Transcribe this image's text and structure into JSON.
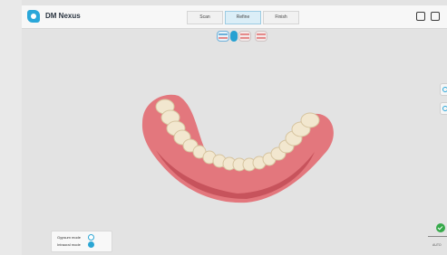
{
  "app": {
    "name": "DM Nexus"
  },
  "steps": {
    "scan": "Scan",
    "refine": "Refine",
    "finish": "Finish",
    "active": "Refine"
  },
  "view_toggles": {
    "selected": "upper",
    "items": [
      "upper",
      "mid",
      "lower",
      "both"
    ]
  },
  "legend": {
    "gypsum_mode": "Gypsum mode",
    "intraoral_mode": "Intraoral mode",
    "selected": "intraoral"
  },
  "colors": {
    "accent": "#2aa7d9",
    "success": "#36a94a",
    "gum": "#e3777d",
    "tooth": "#f2e7cf"
  },
  "bottom_right": {
    "label": "AUTO"
  }
}
